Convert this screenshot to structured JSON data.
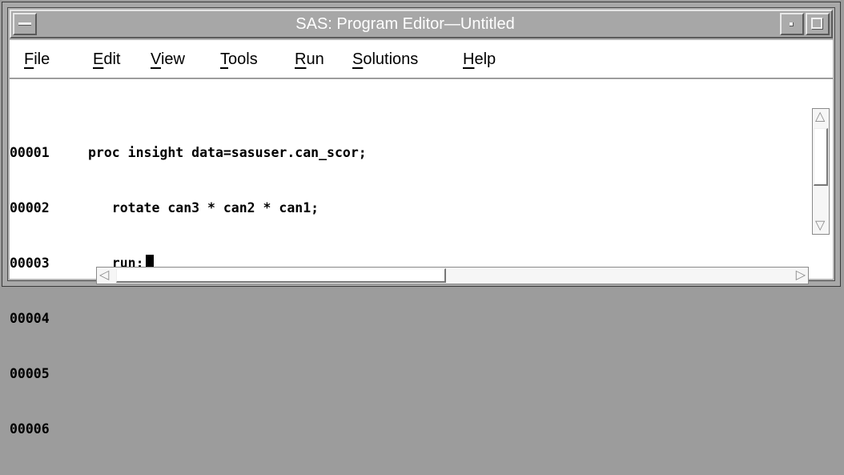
{
  "window": {
    "title": "SAS: Program Editor—Untitled"
  },
  "menubar": {
    "items": [
      {
        "mnemonic": "F",
        "rest": "ile"
      },
      {
        "mnemonic": "E",
        "rest": "dit"
      },
      {
        "mnemonic": "V",
        "rest": "iew"
      },
      {
        "mnemonic": "T",
        "rest": "ools"
      },
      {
        "mnemonic": "R",
        "rest": "un"
      },
      {
        "mnemonic": "S",
        "rest": "olutions"
      },
      {
        "mnemonic": "H",
        "rest": "elp"
      }
    ]
  },
  "editor": {
    "lines": [
      {
        "num": "00001",
        "code": "proc insight data=sasuser.can_scor;"
      },
      {
        "num": "00002",
        "code": "   rotate can3 * can2 * can1;"
      },
      {
        "num": "00003",
        "code": "   run;"
      },
      {
        "num": "00004",
        "code": ""
      },
      {
        "num": "00005",
        "code": ""
      },
      {
        "num": "00006",
        "code": ""
      }
    ]
  },
  "icons": {
    "system_menu": "window-menu-icon",
    "minimize": "minimize-icon",
    "maximize": "maximize-icon",
    "scroll_up": "triangle-up-icon",
    "scroll_down": "triangle-down-icon",
    "scroll_left": "triangle-left-icon",
    "scroll_right": "triangle-right-icon"
  },
  "colors": {
    "chrome": "#a8a8a8",
    "menubar_bg": "#ffffff",
    "editor_bg": "#ffffff",
    "title_text": "#ffffff"
  }
}
